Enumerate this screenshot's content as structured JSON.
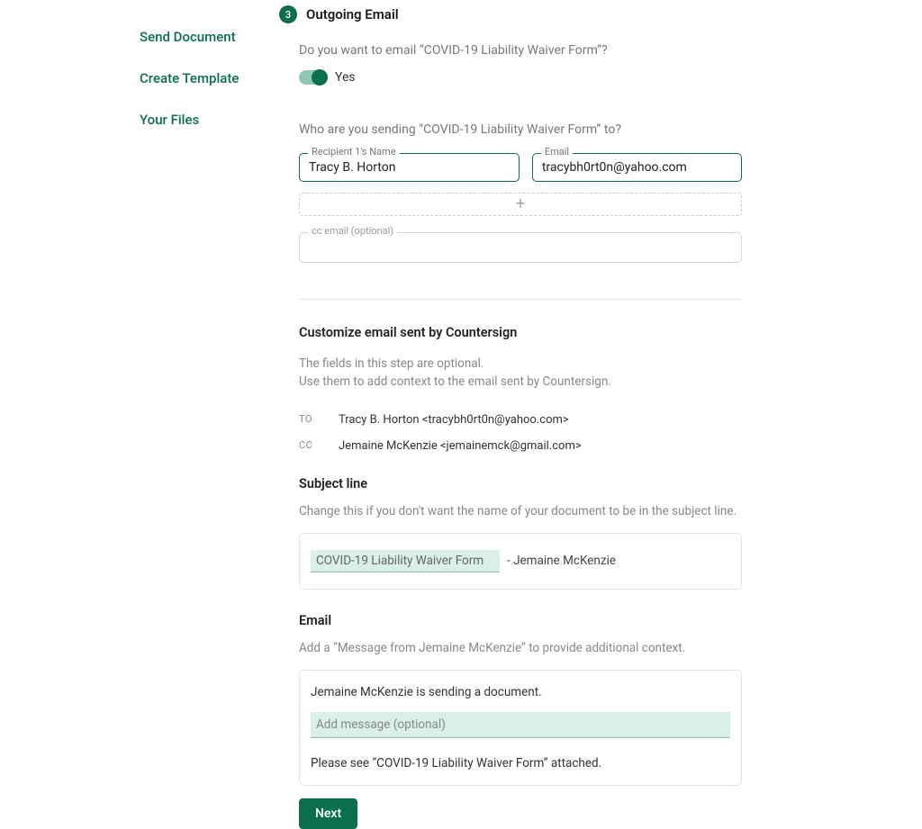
{
  "sidebar": {
    "items": [
      {
        "label": "Send Document"
      },
      {
        "label": "Create Template"
      },
      {
        "label": "Your Files"
      }
    ]
  },
  "step": {
    "number": "3",
    "title": "Outgoing Email"
  },
  "prompt": {
    "question": "Do you want to email “COVID-19 Liability Waiver Form”?",
    "toggle_label": "Yes"
  },
  "recipients": {
    "question": "Who are you sending “COVID-19 Liability Waiver Form” to?",
    "name_label": "Recipient 1's Name",
    "name_value": "Tracy B. Horton",
    "email_label": "Email",
    "email_value": "tracybh0rt0n@yahoo.com",
    "cc_label": "cc email (optional)"
  },
  "customize": {
    "title": "Customize email sent by Countersign",
    "desc_line1": "The fields in this step are optional.",
    "desc_line2": "Use them to add context to the email sent by Countersign.",
    "to_label": "TO",
    "to_value": "Tracy B. Horton <tracybh0rt0n@yahoo.com>",
    "cc_label": "CC",
    "cc_value": "Jemaine McKenzie <jemainemck@gmail.com>"
  },
  "subject": {
    "title": "Subject line",
    "desc": "Change this if you don't want the name of your document to be in the subject line.",
    "value": "COVID-19 Liability Waiver Form",
    "suffix": "- Jemaine McKenzie"
  },
  "email": {
    "title": "Email",
    "desc": "Add a “Message from Jemaine McKenzie” to provide additional context.",
    "intro_line": "Jemaine McKenzie is sending a document.",
    "message_placeholder": "Add message (optional)",
    "footer_line": "Please see “COVID-19 Liability Waiver Form” attached."
  },
  "next_label": "Next"
}
